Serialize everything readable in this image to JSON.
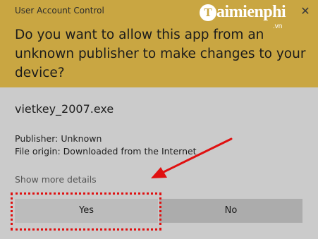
{
  "window": {
    "title": "User Account Control",
    "close_glyph": "✕"
  },
  "watermark": {
    "logo_letter": "T",
    "brand": "aimienphi",
    "suffix": ".vn"
  },
  "prompt": {
    "question": "Do you want to allow this app from an unknown publisher to make changes to your device?"
  },
  "details": {
    "app_name": "vietkey_2007.exe",
    "publisher": "Publisher: Unknown",
    "origin": "File origin: Downloaded from the Internet",
    "show_more": "Show more details"
  },
  "buttons": {
    "yes": "Yes",
    "no": "No"
  },
  "colors": {
    "header_bg": "#c9a642",
    "body_bg": "#cbcbcb",
    "annotation_red": "#e01010"
  }
}
